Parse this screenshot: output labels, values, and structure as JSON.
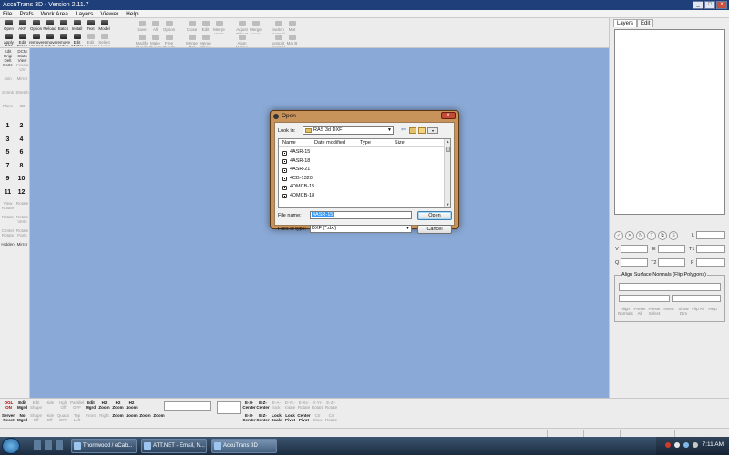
{
  "window": {
    "title": "AccuTrans 3D - Version 2.11.7",
    "controls": [
      "_",
      "□",
      "x"
    ]
  },
  "menu": [
    "File",
    "Prefs",
    "Work Area",
    "Layers",
    "Viewer",
    "Help"
  ],
  "toolbar": {
    "left_buttons": [
      {
        "label": "Open",
        "dim": false
      },
      {
        "label": "AKF",
        "dim": false
      },
      {
        "label": "Option",
        "dim": false
      },
      {
        "label": "Reload",
        "dim": false
      },
      {
        "label": "Batch",
        "dim": false
      },
      {
        "label": "Install",
        "dim": false
      },
      {
        "label": "Text",
        "dim": false
      },
      {
        "label": "Model",
        "dim": false
      },
      {
        "label": "apply Edit",
        "dim": false
      },
      {
        "label": "Edit Batch",
        "dim": false
      },
      {
        "label": "remove unused mat",
        "dim": false
      },
      {
        "label": "remove redun",
        "dim": false
      },
      {
        "label": "remove redun pts",
        "dim": false
      },
      {
        "label": "Edit Model",
        "dim": false
      },
      {
        "label": "Edit Layers",
        "dim": true
      },
      {
        "label": "Select Layers",
        "dim": true
      }
    ],
    "groups": [
      {
        "name": "save",
        "buttons": [
          "Save",
          "All",
          "Option",
          "Modify Quads",
          "Make Quads",
          "Free Quads"
        ]
      },
      {
        "name": "merge",
        "buttons": [
          "Close",
          "Edit",
          "Merge Verts",
          "Merge Mat",
          "Merge Shad"
        ]
      },
      {
        "name": "adjust",
        "buttons": [
          "Adjust Object",
          "Merge Save",
          "Align Norms"
        ]
      },
      {
        "name": "normals",
        "buttons": [
          "switch Normals",
          "Mat",
          "unsplit Normal",
          "Mat B"
        ]
      }
    ]
  },
  "leftbar": {
    "tools": [
      {
        "label": "Edit Origi Delt",
        "dim": false
      },
      {
        "label": "DCM Stats View",
        "dim": false
      },
      {
        "label": "Parts",
        "dim": false
      },
      {
        "label": "Create UV",
        "dim": true
      },
      {
        "label": "Join",
        "dim": true
      },
      {
        "label": "Mirror",
        "dim": true
      },
      {
        "label": "Shrink",
        "dim": true
      },
      {
        "label": "Stretch",
        "dim": true
      },
      {
        "label": "Plane",
        "dim": true
      },
      {
        "label": "3D",
        "dim": true
      }
    ],
    "numbers": [
      "1",
      "2",
      "3",
      "4",
      "5",
      "6",
      "7",
      "8",
      "9",
      "10",
      "11",
      "12"
    ],
    "rotate": [
      {
        "label": "View Rotate",
        "dim": true
      },
      {
        "label": "Rotate",
        "dim": true
      },
      {
        "label": "Rotate",
        "dim": true
      },
      {
        "label": "Rotate Verts",
        "dim": true
      },
      {
        "label": "Center Rotate",
        "dim": true
      },
      {
        "label": "Rotate Parts",
        "dim": true
      },
      {
        "label": "Hidden",
        "dim": false
      },
      {
        "label": "Mirror",
        "dim": false
      }
    ]
  },
  "dialog": {
    "title": "Open",
    "look_in_label": "Look in:",
    "look_in_value": "RAS 3d DXF",
    "columns": [
      "Name",
      "Date modified",
      "Type",
      "Size"
    ],
    "files": [
      "4ASR-15",
      "4ASR-18",
      "4ASR-21",
      "4CB-1320",
      "4DMCB-15",
      "4DMCB-18"
    ],
    "file_name_label": "File name:",
    "file_name_value": "4ASR-15",
    "file_type_label": "Files of type:",
    "file_type_value": "DXF (*.dxf)",
    "open_label": "Open",
    "cancel_label": "Cancel"
  },
  "rightpanel": {
    "tabs": [
      "Layers",
      "Edit"
    ],
    "field_labels": [
      "L",
      "V",
      "E",
      "T1",
      "Q",
      "T2",
      "F"
    ],
    "align_title": "Align Surface Normals (Flip Polygons)",
    "align_buttons": [
      "Align Normals",
      "Preset All",
      "Preset Select",
      "Invert",
      "Show Dirs",
      "Flip All",
      "Help"
    ]
  },
  "bottombar": {
    "row1": [
      {
        "label": "OGL ON",
        "state": "red"
      },
      {
        "label": "Edit Mgrd",
        "state": "on"
      },
      {
        "label": "Edit Shape",
        "state": "off"
      },
      {
        "label": "Hide",
        "state": "off"
      },
      {
        "label": "Hghl Off",
        "state": "off"
      },
      {
        "label": "Parallel OFF",
        "state": "off"
      },
      {
        "label": "Edit Mgrd",
        "state": "on"
      },
      {
        "label": "H2 Zoom",
        "state": "on"
      },
      {
        "label": "H2 Zoom",
        "state": "on"
      },
      {
        "label": "H2 Zoom",
        "state": "on"
      }
    ],
    "row2": [
      {
        "label": "Servers Reset",
        "state": "on"
      },
      {
        "label": "No Mgrd",
        "state": "on"
      },
      {
        "label": "Shape Off",
        "state": "off"
      },
      {
        "label": "Hide Off",
        "state": "off"
      },
      {
        "label": "Quads OFF",
        "state": "off"
      },
      {
        "label": "Top Left",
        "state": "off"
      },
      {
        "label": "Front",
        "state": "off"
      },
      {
        "label": "Right",
        "state": "off"
      },
      {
        "label": "Zoom",
        "state": "on"
      },
      {
        "label": "Zoom",
        "state": "on"
      },
      {
        "label": "Zoom",
        "state": "on"
      },
      {
        "label": "Zoom",
        "state": "on"
      }
    ],
    "row3": [
      {
        "label": "Back",
        "state": "off"
      },
      {
        "label": "Bottom",
        "state": "off"
      }
    ],
    "right_row1": [
      {
        "label": "E-X- Center",
        "state": "on"
      },
      {
        "label": "E-Z- Center",
        "state": "on"
      },
      {
        "label": "E-A- lock",
        "state": "off"
      },
      {
        "label": "D-YL- rotate",
        "state": "off"
      },
      {
        "label": "E-Xs- Rotate",
        "state": "off"
      },
      {
        "label": "E-Yr- Rotate",
        "state": "off"
      },
      {
        "label": "E-Zr- Rotate",
        "state": "off"
      }
    ],
    "right_row2": [
      {
        "label": "E-X- Center",
        "state": "on"
      },
      {
        "label": "E-Z- Center",
        "state": "on"
      },
      {
        "label": "Lock Scale",
        "state": "on"
      },
      {
        "label": "Lock Pivot",
        "state": "on"
      },
      {
        "label": "Center Pivot",
        "state": "on"
      },
      {
        "label": "Ctr Slow",
        "state": "off"
      },
      {
        "label": "Cir Rotate",
        "state": "off"
      }
    ]
  },
  "taskbar": {
    "items": [
      {
        "label": "Thornwood / eCab...",
        "active": false
      },
      {
        "label": "ATT.NET - Email, N...",
        "active": false
      },
      {
        "label": "AccuTrans 3D",
        "active": true
      }
    ],
    "clock": "7:11 AM"
  }
}
